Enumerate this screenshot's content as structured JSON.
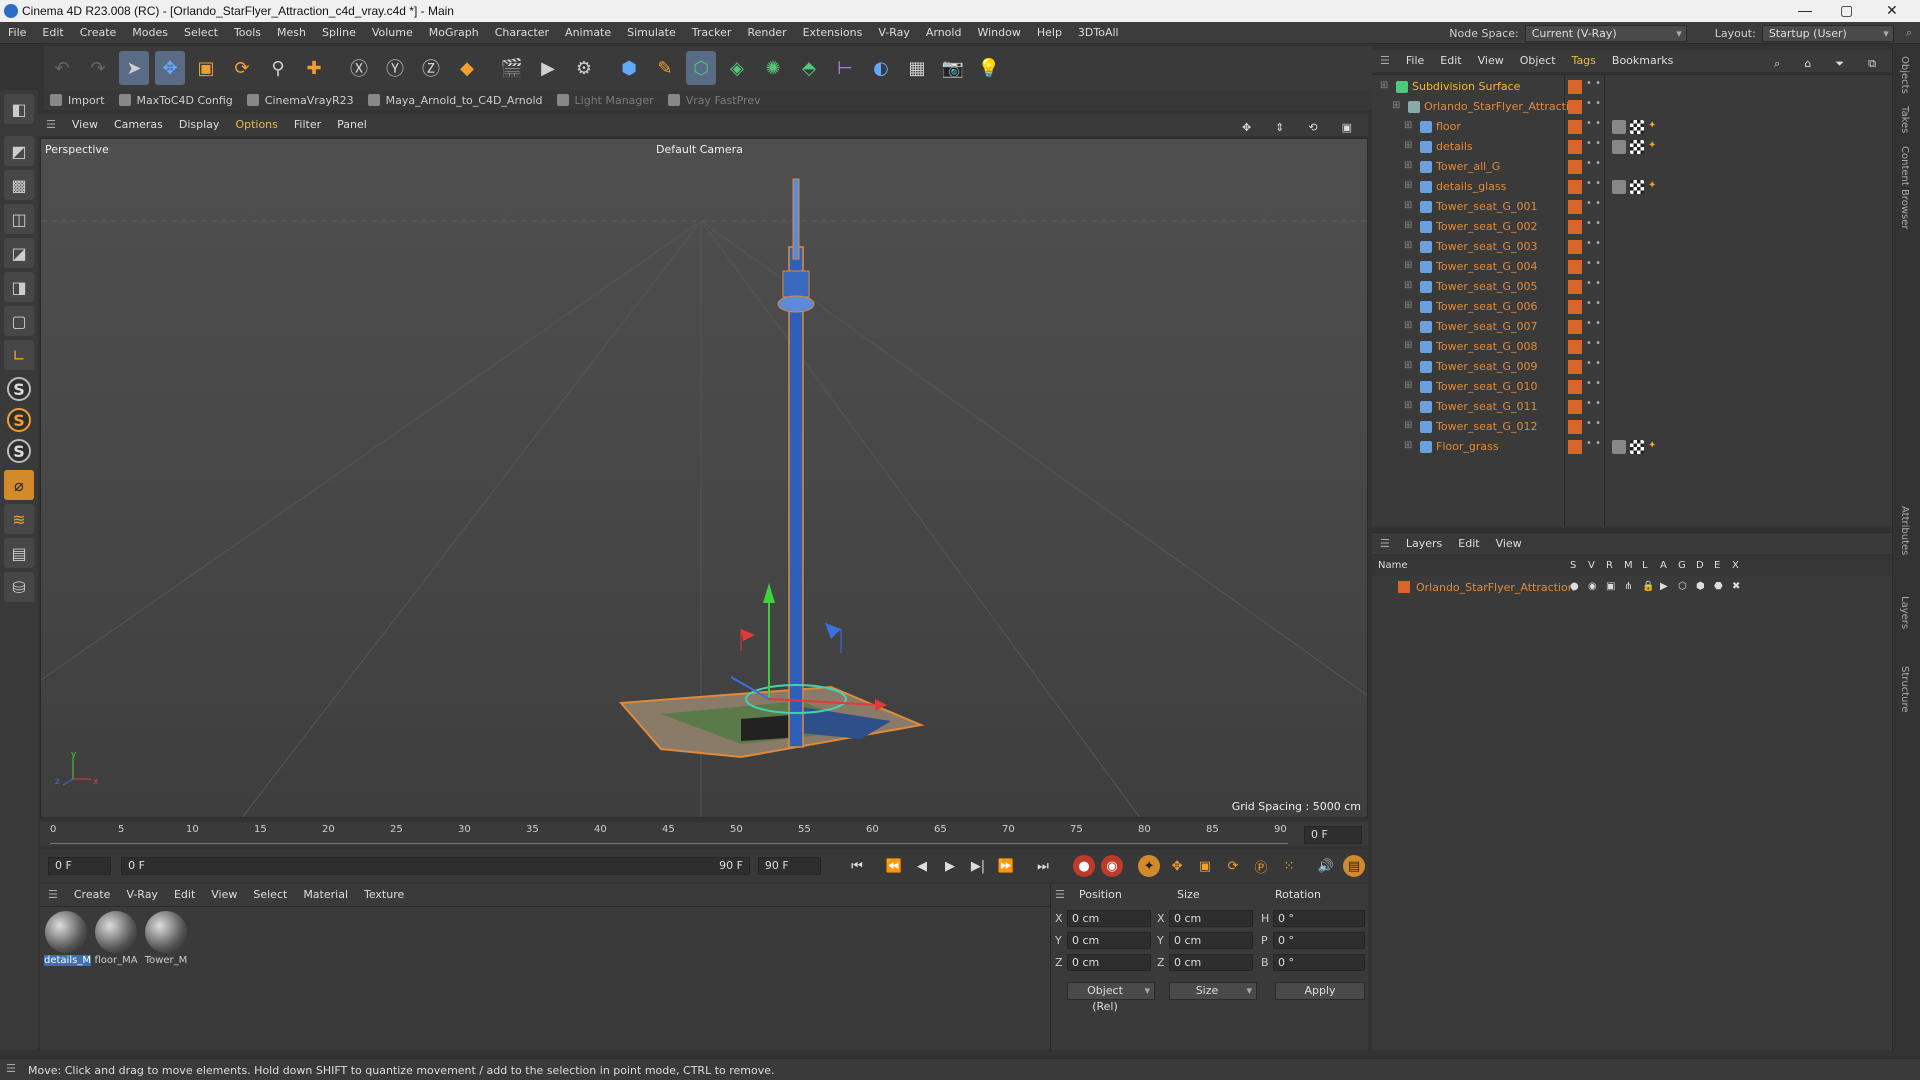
{
  "window": {
    "title": "Cinema 4D R23.008 (RC) - [Orlando_StarFlyer_Attraction_c4d_vray.c4d *] - Main",
    "minimize": "—",
    "maximize": "▢",
    "close": "✕"
  },
  "menubar": {
    "items": [
      "File",
      "Edit",
      "Create",
      "Modes",
      "Select",
      "Tools",
      "Mesh",
      "Spline",
      "Volume",
      "MoGraph",
      "Character",
      "Animate",
      "Simulate",
      "Tracker",
      "Render",
      "Extensions",
      "V-Ray",
      "Arnold",
      "Window",
      "Help",
      "3DToAll"
    ],
    "node_space_label": "Node Space:",
    "node_space_value": "Current (V-Ray)",
    "layout_label": "Layout:",
    "layout_value": "Startup (User)"
  },
  "pluginbar": {
    "items": [
      "Import",
      "MaxToC4D Config",
      "CinemaVrayR23",
      "Maya_Arnold_to_C4D_Arnold",
      "Light Manager",
      "Vray FastPrev"
    ]
  },
  "viewport": {
    "menu": [
      "View",
      "Cameras",
      "Display",
      "Options",
      "Filter",
      "Panel"
    ],
    "highlight_menu": "Options",
    "label": "Perspective",
    "camera": "Default Camera",
    "grid_spacing": "Grid Spacing : 5000 cm"
  },
  "timeline": {
    "ticks": [
      "0",
      "5",
      "10",
      "15",
      "20",
      "25",
      "30",
      "35",
      "40",
      "45",
      "50",
      "55",
      "60",
      "65",
      "70",
      "75",
      "80",
      "85",
      "90"
    ],
    "frame_field": "0 F",
    "start_field": "0 F",
    "current_field": "0 F",
    "end_label": "90 F",
    "end_field": "90 F"
  },
  "materials": {
    "menu": [
      "Create",
      "V-Ray",
      "Edit",
      "View",
      "Select",
      "Material",
      "Texture"
    ],
    "items": [
      {
        "name": "details_M",
        "selected": true
      },
      {
        "name": "floor_MA",
        "selected": false
      },
      {
        "name": "Tower_M",
        "selected": false
      }
    ]
  },
  "coords": {
    "headers": {
      "position": "Position",
      "size": "Size",
      "rotation": "Rotation"
    },
    "rows": [
      {
        "axis": "X",
        "pos": "0 cm",
        "saxis": "X",
        "size": "0 cm",
        "raxis": "H",
        "rot": "0 °"
      },
      {
        "axis": "Y",
        "pos": "0 cm",
        "saxis": "Y",
        "size": "0 cm",
        "raxis": "P",
        "rot": "0 °"
      },
      {
        "axis": "Z",
        "pos": "0 cm",
        "saxis": "Z",
        "size": "0 cm",
        "raxis": "B",
        "rot": "0 °"
      }
    ],
    "mode_dropdown": "Object (Rel)",
    "size_dropdown": "Size",
    "apply": "Apply"
  },
  "status": "Move: Click and drag to move elements. Hold down SHIFT to quantize movement / add to the selection in point mode, CTRL to remove.",
  "objects": {
    "menu": [
      "File",
      "Edit",
      "View",
      "Object",
      "Tags",
      "Bookmarks"
    ],
    "highlight_menu": "Tags",
    "tree": [
      {
        "name": "Subdivision Surface",
        "indent": 0,
        "color": "yellow"
      },
      {
        "name": "Orlando_StarFlyer_Attraction",
        "indent": 1,
        "color": "orange"
      },
      {
        "name": "floor",
        "indent": 2,
        "color": "orange",
        "tags": true
      },
      {
        "name": "details",
        "indent": 2,
        "color": "orange",
        "tags": true
      },
      {
        "name": "Tower_all_G",
        "indent": 2,
        "color": "orange"
      },
      {
        "name": "details_glass",
        "indent": 2,
        "color": "orange",
        "tags": true
      },
      {
        "name": "Tower_seat_G_001",
        "indent": 2,
        "color": "orange"
      },
      {
        "name": "Tower_seat_G_002",
        "indent": 2,
        "color": "orange"
      },
      {
        "name": "Tower_seat_G_003",
        "indent": 2,
        "color": "orange"
      },
      {
        "name": "Tower_seat_G_004",
        "indent": 2,
        "color": "orange"
      },
      {
        "name": "Tower_seat_G_005",
        "indent": 2,
        "color": "orange"
      },
      {
        "name": "Tower_seat_G_006",
        "indent": 2,
        "color": "orange"
      },
      {
        "name": "Tower_seat_G_007",
        "indent": 2,
        "color": "orange"
      },
      {
        "name": "Tower_seat_G_008",
        "indent": 2,
        "color": "orange"
      },
      {
        "name": "Tower_seat_G_009",
        "indent": 2,
        "color": "orange"
      },
      {
        "name": "Tower_seat_G_010",
        "indent": 2,
        "color": "orange"
      },
      {
        "name": "Tower_seat_G_011",
        "indent": 2,
        "color": "orange"
      },
      {
        "name": "Tower_seat_G_012",
        "indent": 2,
        "color": "orange"
      },
      {
        "name": "Floor_grass",
        "indent": 2,
        "color": "orange",
        "tags": true
      }
    ]
  },
  "layers": {
    "menu": [
      "Layers",
      "Edit",
      "View"
    ],
    "columns": [
      "Name",
      "S",
      "V",
      "R",
      "M",
      "L",
      "A",
      "G",
      "D",
      "E",
      "X"
    ],
    "items": [
      {
        "name": "Orlando_StarFlyer_Attraction"
      }
    ]
  },
  "sidetabs": [
    "Objects",
    "Takes",
    "Content Browser",
    "Attributes",
    "Layers",
    "Structure"
  ],
  "colors": {
    "accent_orange": "#e08a3a",
    "yellow_text": "#f5b935",
    "selection_blue": "#3d6fb8"
  }
}
